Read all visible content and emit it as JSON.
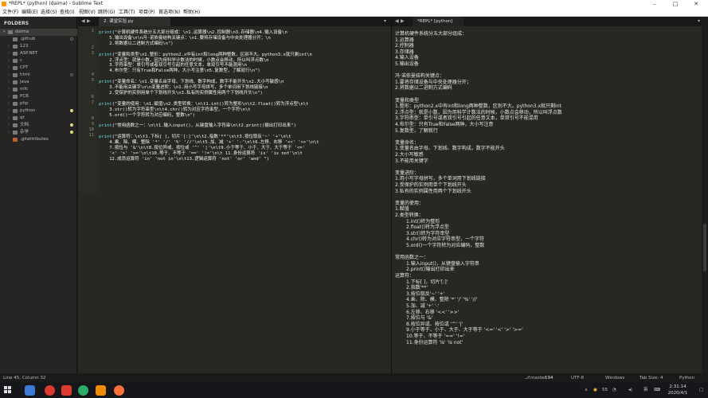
{
  "window": {
    "title": "*REPL* (python) (daima) - Sublime Text"
  },
  "menu": [
    "文件(F)",
    "编辑(E)",
    "选择(S)",
    "查找(I)",
    "视图(V)",
    "跳转(G)",
    "工具(T)",
    "项目(P)",
    "首选项(N)",
    "帮助(H)"
  ],
  "sidebar": {
    "header": "FOLDERS",
    "items": [
      {
        "label": "daima",
        "level": 0,
        "expanded": true
      },
      {
        "label": ".github",
        "level": 1
      },
      {
        "label": "123",
        "level": 1
      },
      {
        "label": "ASP.NET",
        "level": 1
      },
      {
        "label": "c",
        "level": 1
      },
      {
        "label": "CPT",
        "level": 1
      },
      {
        "label": "html",
        "level": 1
      },
      {
        "label": "java",
        "level": 1
      },
      {
        "label": "mfc",
        "level": 1
      },
      {
        "label": "PCB",
        "level": 1
      },
      {
        "label": "php",
        "level": 1
      },
      {
        "label": "python",
        "level": 1
      },
      {
        "label": "qt",
        "level": 1
      },
      {
        "label": "文档",
        "level": 1
      },
      {
        "label": "杂学",
        "level": 1
      },
      {
        "label": ".gitattributes",
        "level": 1
      }
    ]
  },
  "tabs": {
    "left": "2. 课堂实验.py",
    "right": "*REPL* [python]"
  },
  "editor": {
    "lines": [
      {
        "n": "1",
        "t": "print(\"计算机硬件系统分五大部分组成：\\n1.运算器\\n2.控制器\\n3.存储器\\n4.输入设备\\n"
      },
      {
        "n": "",
        "t": "    5.输出设备\\n\\n冯·诺依曼结构关键点：\\n1.要将存储设备与中央处理器分开；\\n"
      },
      {
        "n": "",
        "t": "    2.将数据以二进制方式编码\\n\")"
      },
      {
        "n": "2",
        "t": ""
      },
      {
        "n": "3",
        "t": "print(\"变量和类型\\n1.整形：python2.x中有int和long两种整数，区别不大。python3.x就只剩int\\n"
      },
      {
        "n": "",
        "t": "    2.浮点型：就是小数，因为用科学计数法的时候，小数点会移动，所以叫浮点数\\n"
      },
      {
        "n": "",
        "t": "    3.字符串型：单引号或者双引号引起的任意文本，单双引号不能混用\\n"
      },
      {
        "n": "",
        "t": "    4.布尔型：只有True和False两种，大小写注意\\n5.复数型，了解就行\\n\")"
      },
      {
        "n": "4",
        "t": ""
      },
      {
        "n": "5",
        "t": "print(\"变量命名：\\n1.变量名由字母、下划线、数字构成，数字不能开头\\n2.大小写敏感\\n"
      },
      {
        "n": "",
        "t": "    3.不能用关键字\\n\\n变量进阶：\\n1.用小写字母拼写，多个单词用下划线链接\\n"
      },
      {
        "n": "",
        "t": "    2.受保护的实例用单个下划线开头\\n3.私有的实例属性用两个下划线开头\\n\")"
      },
      {
        "n": "6",
        "t": ""
      },
      {
        "n": "7",
        "t": "print(\"变量的使用：\\n1.赋值\\n2.类型转换：\\n\\t1.int()转为整形\\n\\t2.float()转为浮点型\\n\\t"
      },
      {
        "n": "",
        "t": "    3.str()转为字符串型\\n\\t4.chr()转为对应字符串型，一个字符\\n\\t"
      },
      {
        "n": "",
        "t": "    5.ord()一个字符转为对应编码，整数\\n\")"
      },
      {
        "n": "8",
        "t": ""
      },
      {
        "n": "9",
        "t": "print(\"常用函数之一：\\n\\t1.输入input()，从键盘输入字符串\\n\\t2.print()输出打印出来\")"
      },
      {
        "n": "10",
        "t": ""
      },
      {
        "n": "11",
        "t": "print(\"运算符：\\n\\t1.下标[ ]，切片'[:]'\\n\\t2.指数'**'\\n\\t3.按位取反'~' '+'\\n\\t"
      },
      {
        "n": "",
        "t": "    4.乘、除、模、整除 '*' '/' '%' '//'\\n\\t5.加、减 '+' '-'\\n\\t6.左移、右移 '<<' '>>'\\n\\t"
      },
      {
        "n": "",
        "t": "    7.按位与 '&'\\n\\t8.按位异或、按位或 '^' '|'\\n\\t9.小于等于、小于、大于、大于等于 '<='"
      },
      {
        "n": "",
        "t": "    '<' '>' '>='\\n\\t10.等于、不等于 '==' '!='\\n\\t 11.身份运算符 'is' 'is not'\\n\\t"
      },
      {
        "n": "",
        "t": "    12.成员运算符 'in' 'not in'\\n\\t13.逻辑运算符 'not' 'or' 'and' \")"
      }
    ]
  },
  "output": {
    "lines": [
      {
        "t": "计算机硬件系统分五大部分组成：",
        "i": 0
      },
      {
        "t": "1.运算器",
        "i": 0
      },
      {
        "t": "2.控制器",
        "i": 0
      },
      {
        "t": "3.存储器",
        "i": 0
      },
      {
        "t": "4.输入设备",
        "i": 0
      },
      {
        "t": "5.输出设备",
        "i": 0
      },
      {
        "t": "",
        "i": 0
      },
      {
        "t": "冯·诺依曼结构关键点：",
        "i": 0
      },
      {
        "t": "1.要将存储设备与中央处理器分开；",
        "i": 0
      },
      {
        "t": "2.将数据以二进制方式编码",
        "i": 0
      },
      {
        "t": "",
        "i": 0
      },
      {
        "t": "变量和类型",
        "i": 0
      },
      {
        "t": "1.整形：python2.x中有int和long两种整数，区别不大。python3.x就只剩int",
        "i": 0
      },
      {
        "t": "2.浮点型：就是小数，因为用科学计数法的时候，小数点会移动，所以叫浮点数",
        "i": 0
      },
      {
        "t": "3.字符串型：单引号或者双引号引起的任意文本，单双引号不能混用",
        "i": 0
      },
      {
        "t": "4.布尔型：只有True和False两种，大小写注意",
        "i": 0
      },
      {
        "t": "5.复数型，了解就行",
        "i": 0
      },
      {
        "t": "",
        "i": 0
      },
      {
        "t": "变量命名：",
        "i": 0
      },
      {
        "t": "1.变量名由字母、下划线、数字构成，数字不能开头",
        "i": 0
      },
      {
        "t": "2.大小写敏感",
        "i": 0
      },
      {
        "t": "3.不能用关键字",
        "i": 0
      },
      {
        "t": "",
        "i": 0
      },
      {
        "t": "变量进阶：",
        "i": 0
      },
      {
        "t": "1.用小写字母拼写，多个单词用下划线链接",
        "i": 0
      },
      {
        "t": "2.受保护的实例用单个下划线开头",
        "i": 0
      },
      {
        "t": "3.私有的实例属性用两个下划线开头",
        "i": 0
      },
      {
        "t": "",
        "i": 0
      },
      {
        "t": "变量的使用：",
        "i": 0
      },
      {
        "t": "1.赋值",
        "i": 0
      },
      {
        "t": "2.类型转换：",
        "i": 0
      },
      {
        "t": "1.int()转为整形",
        "i": 1
      },
      {
        "t": "2.float()转为浮点型",
        "i": 1
      },
      {
        "t": "3.str()转为字符串型",
        "i": 1
      },
      {
        "t": "4.chr()转为对应字符串型，一个字符",
        "i": 1
      },
      {
        "t": "5.ord()一个字符转为对应编码，整数",
        "i": 1
      },
      {
        "t": "",
        "i": 0
      },
      {
        "t": "常用函数之一：",
        "i": 0
      },
      {
        "t": "1.输入input()，从键盘输入字符串",
        "i": 1
      },
      {
        "t": "2.print()输出打印出来",
        "i": 1
      },
      {
        "t": "运算符：",
        "i": 0
      },
      {
        "t": "1.下标[ ]，切片'[:]'",
        "i": 1
      },
      {
        "t": "2.指数'**'",
        "i": 1
      },
      {
        "t": "3.按位取反'~' '+'",
        "i": 1
      },
      {
        "t": "4.乘、除、模、整除 '*' '/' '%' '//'",
        "i": 1
      },
      {
        "t": "5.加、减 '+' '-'",
        "i": 1
      },
      {
        "t": "6.左移、右移 '<<' '>>'",
        "i": 1
      },
      {
        "t": "7.按位与 '&'",
        "i": 1
      },
      {
        "t": "8.按位异或、按位或 '^' '|'",
        "i": 1
      },
      {
        "t": "9.小于等于、小于、大于、大于等于 '<=' '<' '>' '>='",
        "i": 1
      },
      {
        "t": "10.等于、不等于 '==' '!='",
        "i": 1
      },
      {
        "t": " 11.身份运算符 'is' 'is not'",
        "i": 1
      }
    ]
  },
  "status": {
    "position": "Line 45, Column 32",
    "branch": "master",
    "badge": "194",
    "encoding": "UTF-8",
    "line_endings": "Windows",
    "tab_size": "Tab Size: 4",
    "syntax": "Python"
  },
  "taskbar": {
    "time": "2:31:14",
    "date": "2020/4/1",
    "lang": "英",
    "tray_num": "55"
  },
  "colors": {
    "accent": "#a6e22e",
    "keyword": "#66d9ef",
    "background": "#272822"
  }
}
